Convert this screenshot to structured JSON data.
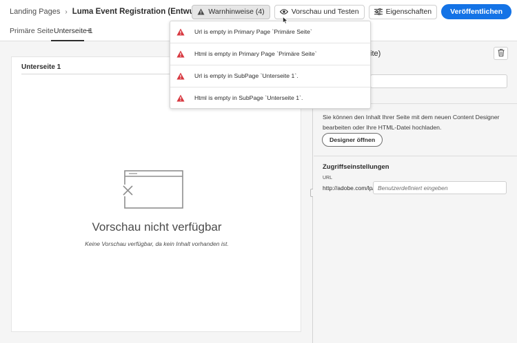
{
  "breadcrumb": {
    "root": "Landing Pages",
    "separator": "›",
    "title": "Luma Event Registration (Entwurf)"
  },
  "header": {
    "warnings_label": "Warnhinweise (4)",
    "preview_label": "Vorschau und Testen",
    "properties_label": "Eigenschaften",
    "publish_label": "Veröffentlichen",
    "accent_color": "#1473e6"
  },
  "tabs": [
    {
      "label": "Primäre Seite"
    },
    {
      "label": "Unterseite 1"
    }
  ],
  "tab_add": "+",
  "card": {
    "title": "Unterseite 1",
    "empty_title": "Vorschau nicht verfügbar",
    "empty_subtitle": "Keine Vorschau verfügbar, da kein Inhalt vorhanden ist."
  },
  "right_panel": {
    "title_fragment": "ite)",
    "description": "Sie können den Inhalt Ihrer Seite mit dem neuen Content Designer bearbeiten oder Ihre HTML-Datei hochladen.",
    "designer_button": "Designer öffnen",
    "access_title": "Zugriffseinstellungen",
    "url_label": "URL",
    "url_prefix": "http://adobe.com/lp/",
    "url_placeholder": "Benutzerdefiniert eingeben"
  },
  "warnings": [
    {
      "text": "Url is empty in Primary Page `Primäre Seite`"
    },
    {
      "text": "Html is empty in Primary Page `Primäre Seite`"
    },
    {
      "text": "Url is empty in SubPage `Unterseite 1`."
    },
    {
      "text": "Html is empty in SubPage `Unterseite 1`."
    }
  ],
  "warning_icon_color": "#d7373f"
}
